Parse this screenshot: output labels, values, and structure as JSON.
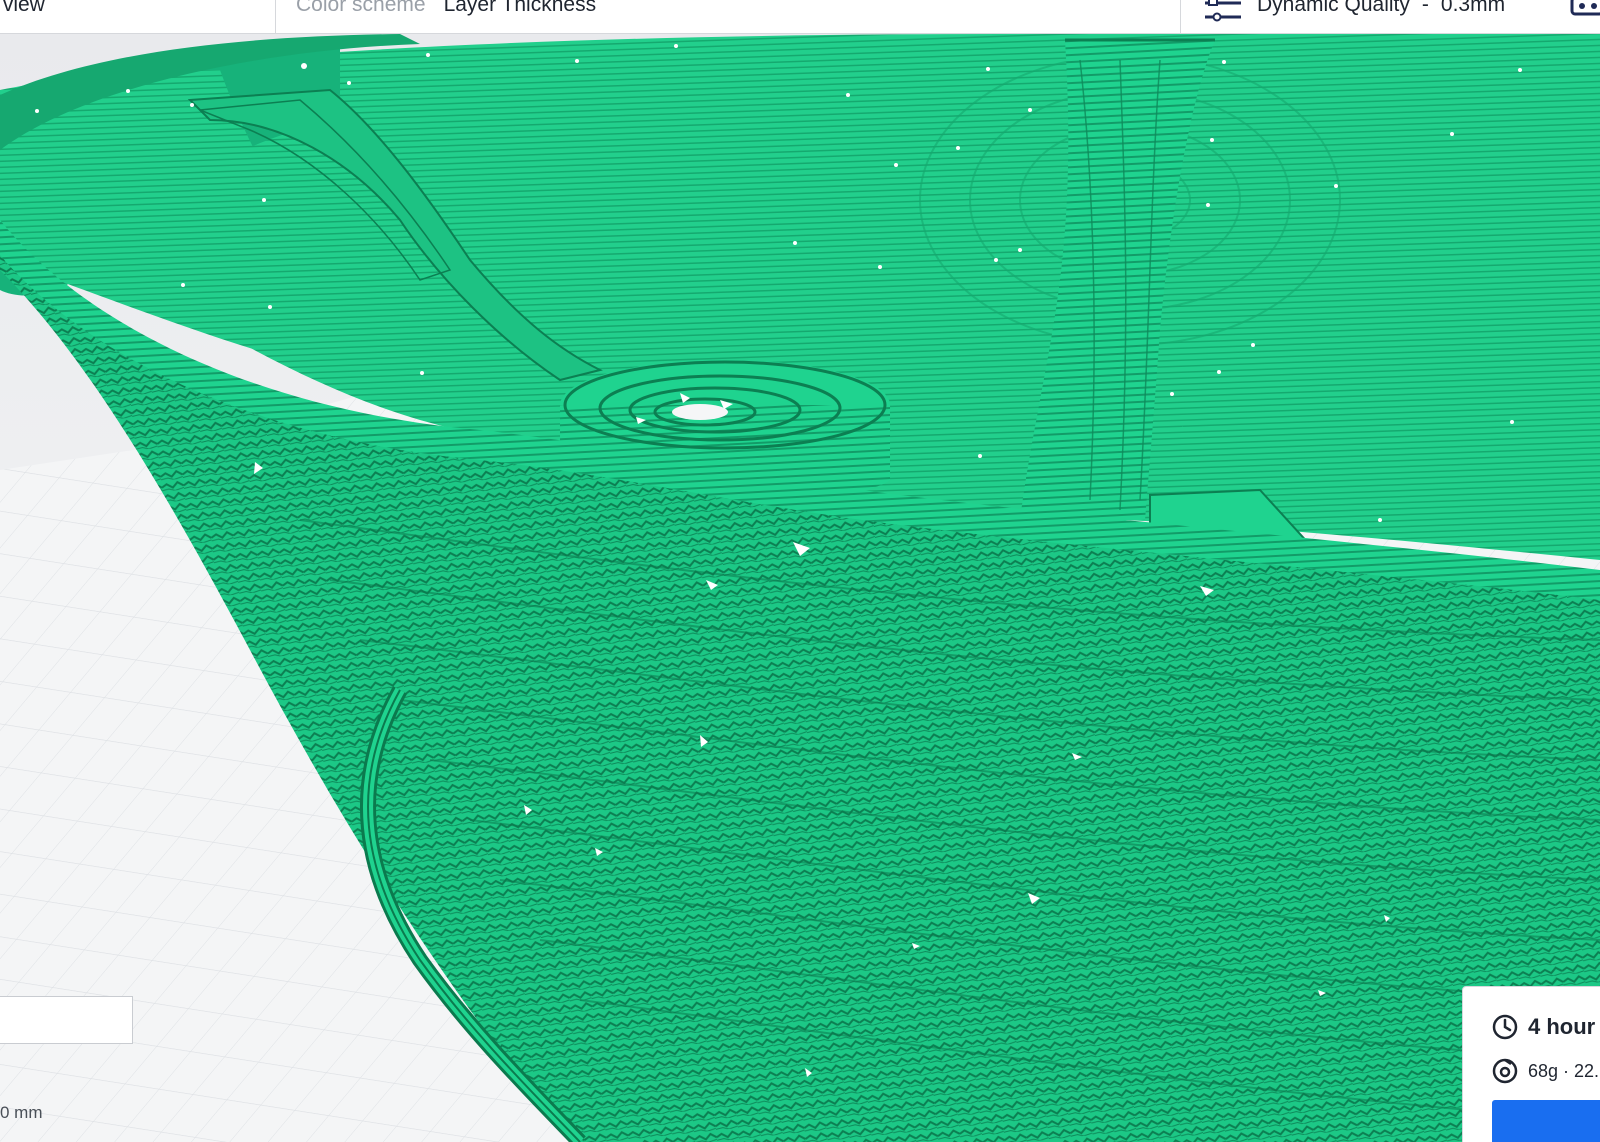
{
  "toolbar": {
    "view_mode": "X-Ray view",
    "view_mode_visible": "r view",
    "color_scheme_label": "Color scheme",
    "color_scheme_value": "Layer Thickness",
    "profile_name": "Dynamic Quality",
    "profile_separator": "-",
    "layer_height": "0.3mm"
  },
  "viewport": {
    "distance_label": "0 mm",
    "layer_input_value": ""
  },
  "print_info": {
    "time": "4 hour",
    "material": "68g · 22."
  },
  "colors": {
    "filament": "#1fd38f",
    "filament_dark": "#0b7a4e",
    "build_plate": "#f0f1f3",
    "grid_line": "#dcdfe3",
    "accent": "#196ef0"
  },
  "icons": [
    "settings-sliders-icon",
    "support-icon",
    "clock-icon",
    "spool-icon"
  ]
}
